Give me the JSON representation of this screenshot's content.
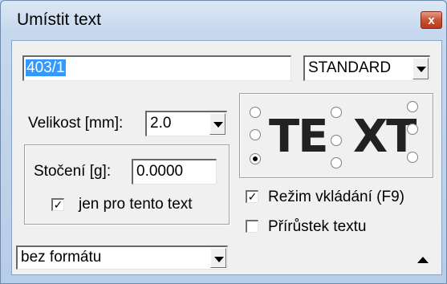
{
  "window": {
    "title": "Umístit text",
    "close_glyph": "x"
  },
  "text_input": {
    "value": "403/1"
  },
  "style_select": {
    "value": "STANDARD"
  },
  "size": {
    "label": "Velikost [mm]:",
    "value": "2.0"
  },
  "rotation": {
    "label": "Stočení [g]:",
    "value": "0.0000",
    "checkbox_label": "jen pro tento text",
    "checkbox_checked": true
  },
  "alignment": {
    "preview_text_left": "TE",
    "preview_text_right": "XT",
    "selected": "bottom-left"
  },
  "insert_mode": {
    "label": "Režim vkládání (F9)",
    "checked": true
  },
  "increment": {
    "label": "Přírůstek textu",
    "checked": false
  },
  "format_select": {
    "value": "bez formátu"
  },
  "icons": {
    "close": "close-icon",
    "collapse": "collapse-up-arrow-icon",
    "dropdown": "chevron-down-icon"
  },
  "colors": {
    "selection": "#3399ff",
    "close_button": "#c95234",
    "dialog_bg": "#f0f0f0"
  }
}
